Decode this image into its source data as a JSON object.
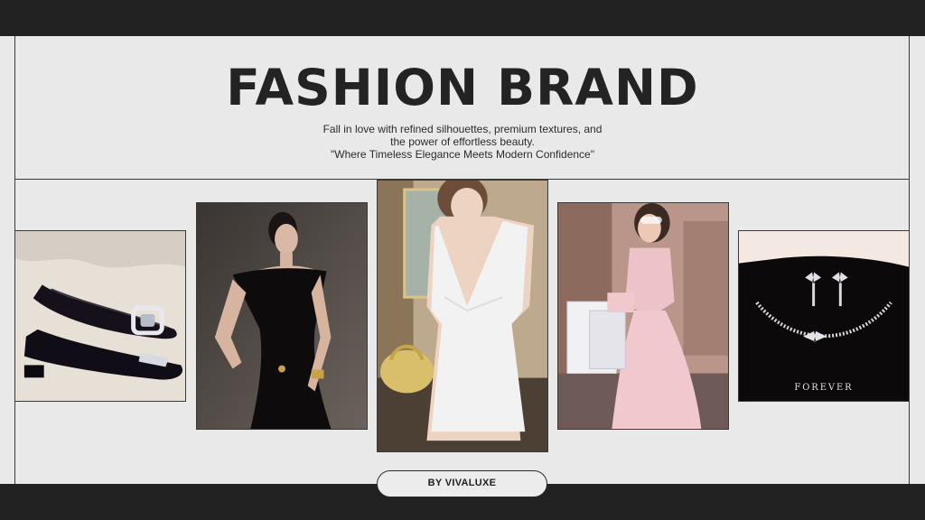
{
  "header": {
    "title": "FASHION BRAND",
    "subtitle_lines": [
      "Fall in love with refined silhouettes, premium textures, and",
      "the power of effortless beauty.",
      "\"Where Timeless Elegance Meets Modern Confidence\""
    ]
  },
  "gallery": [
    {
      "subject": "black-velvet-flats-with-crystal-buckles"
    },
    {
      "subject": "black-off-shoulder-dress"
    },
    {
      "subject": "white-sequin-dress-with-gold-clutch"
    },
    {
      "subject": "pink-satin-dress-with-shopping-bags"
    },
    {
      "subject": "diamond-bow-necklace-and-earrings",
      "display_text": "FOREVER"
    }
  ],
  "footer": {
    "badge_label": "BY VIVALUXE"
  },
  "colors": {
    "dark_bar": "#222222",
    "background": "#e9e9e9",
    "text": "#232323"
  }
}
